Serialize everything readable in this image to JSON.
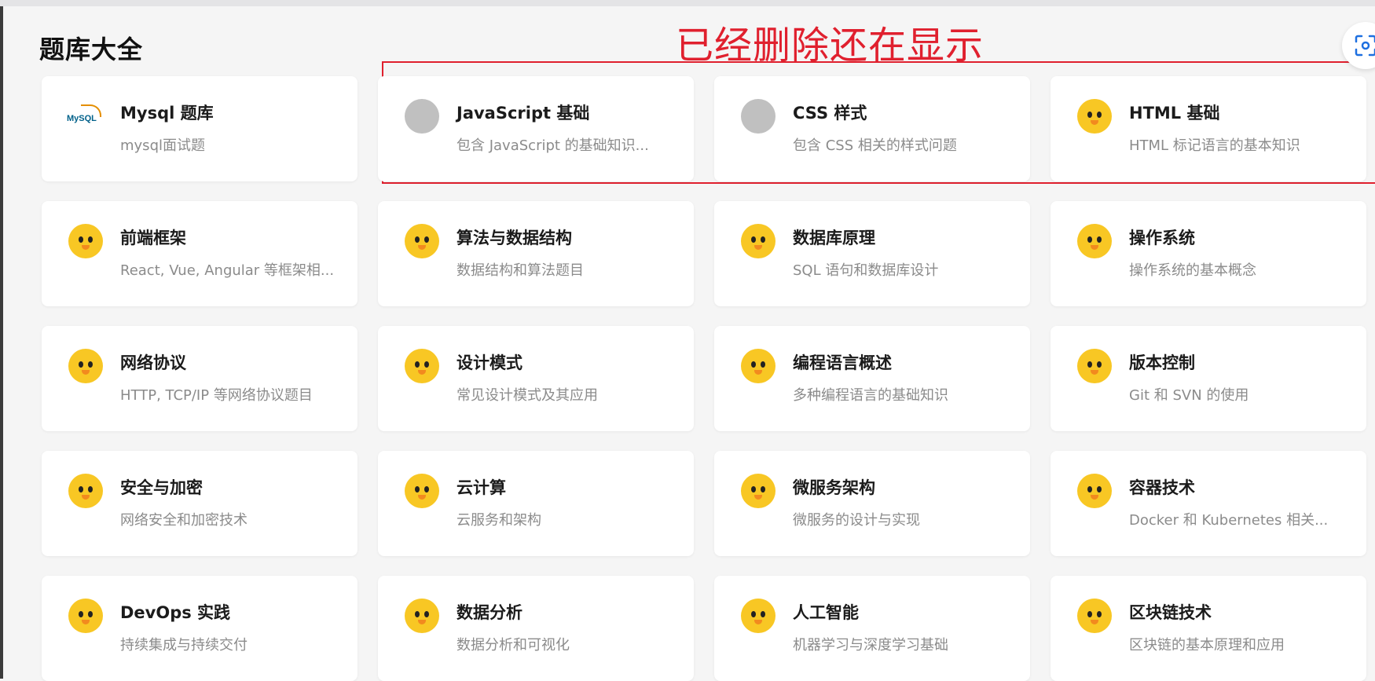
{
  "page": {
    "title": "题库大全",
    "annotation": "已经删除还在显示"
  },
  "cards": [
    {
      "title": "Mysql 题库",
      "desc": "mysql面试题",
      "icon": "mysql-logo-icon"
    },
    {
      "title": "JavaScript 基础",
      "desc": "包含 JavaScript 的基础知识...",
      "icon": "placeholder-avatar-icon"
    },
    {
      "title": "CSS 样式",
      "desc": "包含 CSS 相关的样式问题",
      "icon": "placeholder-avatar-icon"
    },
    {
      "title": "HTML 基础",
      "desc": "HTML 标记语言的基本知识",
      "icon": "duck-icon"
    },
    {
      "title": "前端框架",
      "desc": "React, Vue, Angular 等框架相...",
      "icon": "duck-icon"
    },
    {
      "title": "算法与数据结构",
      "desc": "数据结构和算法题目",
      "icon": "duck-icon"
    },
    {
      "title": "数据库原理",
      "desc": "SQL 语句和数据库设计",
      "icon": "duck-icon"
    },
    {
      "title": "操作系统",
      "desc": "操作系统的基本概念",
      "icon": "duck-icon"
    },
    {
      "title": "网络协议",
      "desc": "HTTP, TCP/IP 等网络协议题目",
      "icon": "duck-icon"
    },
    {
      "title": "设计模式",
      "desc": "常见设计模式及其应用",
      "icon": "duck-icon"
    },
    {
      "title": "编程语言概述",
      "desc": "多种编程语言的基础知识",
      "icon": "duck-icon"
    },
    {
      "title": "版本控制",
      "desc": "Git 和 SVN 的使用",
      "icon": "duck-icon"
    },
    {
      "title": "安全与加密",
      "desc": "网络安全和加密技术",
      "icon": "duck-icon"
    },
    {
      "title": "云计算",
      "desc": "云服务和架构",
      "icon": "duck-icon"
    },
    {
      "title": "微服务架构",
      "desc": "微服务的设计与实现",
      "icon": "duck-icon"
    },
    {
      "title": "容器技术",
      "desc": "Docker 和 Kubernetes 相关...",
      "icon": "duck-icon"
    },
    {
      "title": "DevOps 实践",
      "desc": "持续集成与持续交付",
      "icon": "duck-icon"
    },
    {
      "title": "数据分析",
      "desc": "数据分析和可视化",
      "icon": "duck-icon"
    },
    {
      "title": "人工智能",
      "desc": "机器学习与深度学习基础",
      "icon": "duck-icon"
    },
    {
      "title": "区块链技术",
      "desc": "区块链的基本原理和应用",
      "icon": "duck-icon"
    }
  ],
  "mysql_logo_text": "MySQL",
  "colors": {
    "annotation": "#e0202e",
    "duck": "#f8c724",
    "placeholder": "#c0c0c0"
  }
}
